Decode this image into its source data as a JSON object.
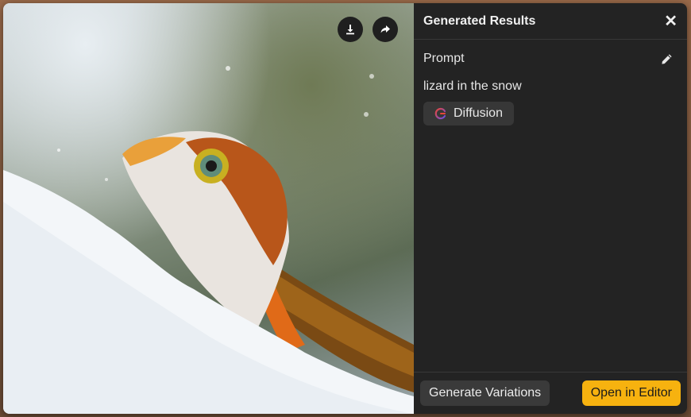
{
  "image_actions": {
    "download_icon": "download-icon",
    "share_icon": "share-icon"
  },
  "panel": {
    "title": "Generated Results",
    "close_glyph": "✕"
  },
  "prompt": {
    "label": "Prompt",
    "text": "lizard in the snow",
    "edit_icon": "pencil-icon"
  },
  "model": {
    "label": "Diffusion",
    "icon": "diffusion-logo-icon"
  },
  "footer": {
    "generate_variations": "Generate Variations",
    "open_in_editor": "Open in Editor"
  },
  "colors": {
    "panel_bg": "#232323",
    "accent": "#f7b20f",
    "chip_bg": "#373737"
  }
}
